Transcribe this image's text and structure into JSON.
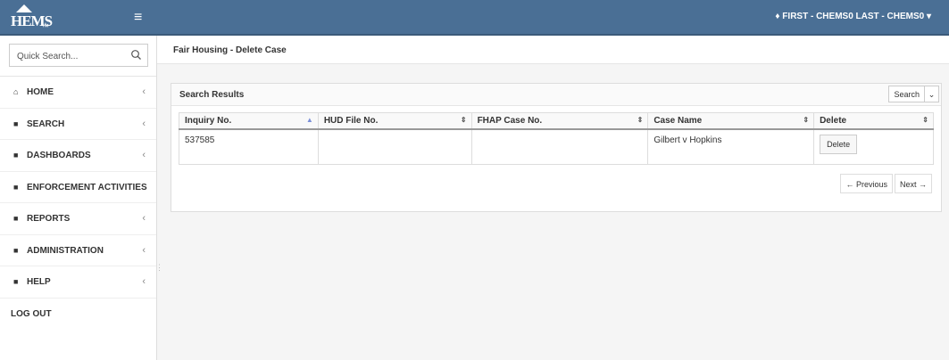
{
  "app": {
    "logo_text": "HEMS",
    "logo_tm": "™",
    "menu_toggle": "≡"
  },
  "user": {
    "label": "♦ FIRST - CHEMS0 LAST - CHEMS0 ▾"
  },
  "sidebar": {
    "search_placeholder": "Quick Search...",
    "items": [
      {
        "label": "HOME",
        "icon": "home-icon",
        "glyph": "⌂",
        "chevron": "‹"
      },
      {
        "label": "SEARCH",
        "icon": "document-icon",
        "glyph": "■",
        "chevron": "‹"
      },
      {
        "label": "DASHBOARDS",
        "icon": "document-icon",
        "glyph": "■",
        "chevron": "‹"
      },
      {
        "label": "ENFORCEMENT ACTIVITIES",
        "icon": "document-icon",
        "glyph": "■",
        "chevron": ""
      },
      {
        "label": "REPORTS",
        "icon": "document-icon",
        "glyph": "■",
        "chevron": "‹"
      },
      {
        "label": "ADMINISTRATION",
        "icon": "document-icon",
        "glyph": "■",
        "chevron": "‹"
      },
      {
        "label": "HELP",
        "icon": "document-icon",
        "glyph": "■",
        "chevron": "‹"
      }
    ],
    "logout": "LOG OUT"
  },
  "page": {
    "title": "Fair Housing - Delete Case"
  },
  "results": {
    "title": "Search Results",
    "search_button": "Search",
    "dropdown": "⌄",
    "columns": [
      "Inquiry No.",
      "HUD File No.",
      "FHAP Case No.",
      "Case Name",
      "Delete"
    ],
    "sort_active": "▲",
    "sort_idle": "⇕",
    "rows": [
      {
        "inquiry": "537585",
        "hud": "",
        "fhap": "",
        "case_name": "Gilbert v Hopkins",
        "delete": "Delete"
      }
    ],
    "pager": {
      "previous": "← Previous",
      "next": "Next →"
    }
  },
  "colors": {
    "topbar": "#4a6f95",
    "sort_active": "#7a8fd8"
  }
}
